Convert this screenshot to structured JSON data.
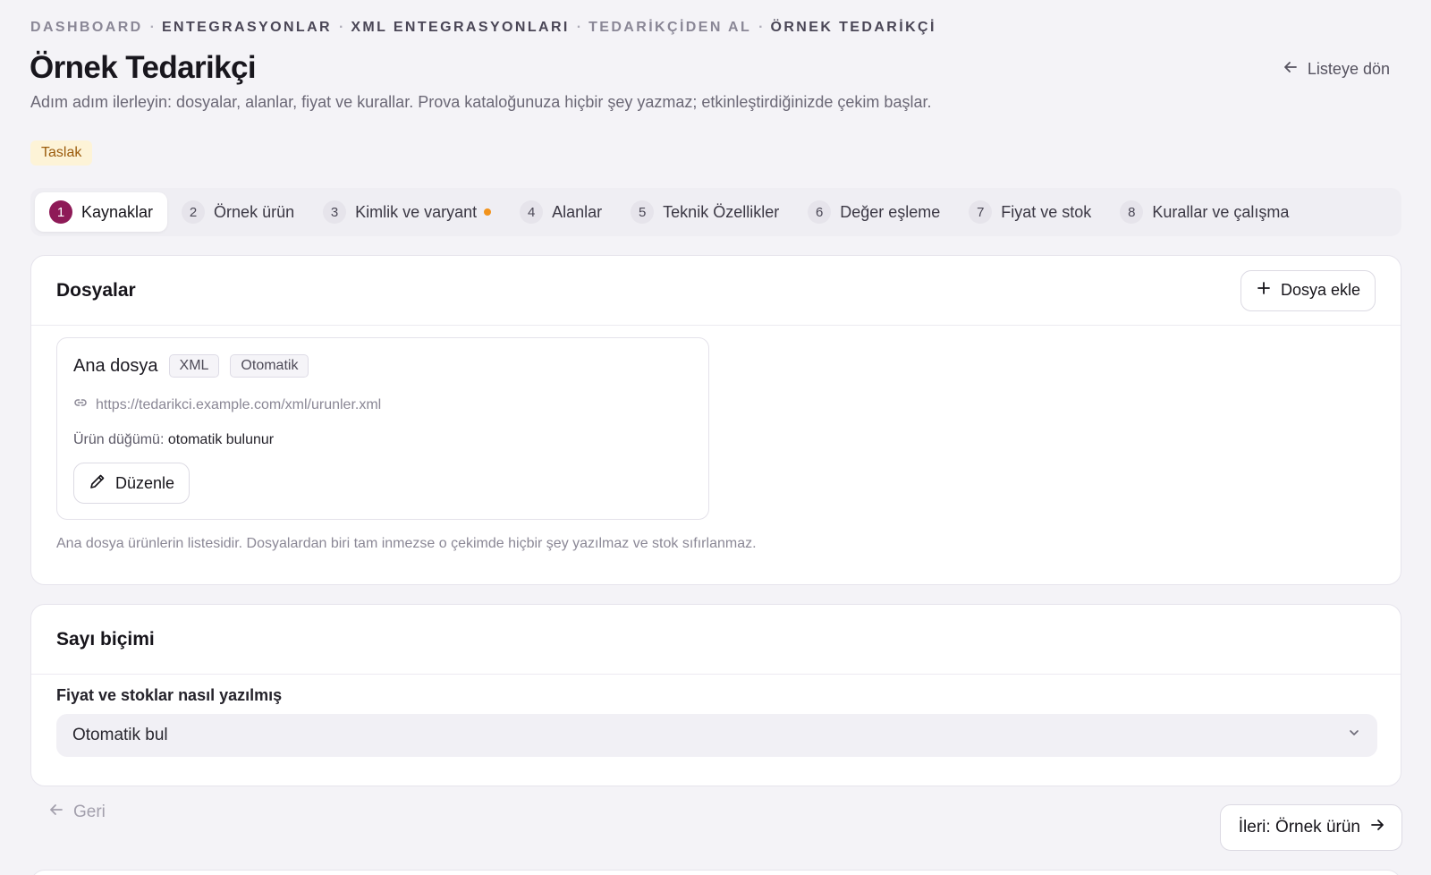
{
  "breadcrumb": [
    "DASHBOARD",
    "ENTEGRASYONLAR",
    "XML ENTEGRASYONLARI",
    "TEDARİKÇİDEN AL",
    "ÖRNEK TEDARİKÇİ"
  ],
  "header": {
    "title": "Örnek Tedarikçi",
    "subtitle": "Adım adım ilerleyin: dosyalar, alanlar, fiyat ve kurallar. Prova kataloğunuza hiçbir şey yazmaz; etkinleştirdiğinizde çekim başlar.",
    "back_label": "Listeye dön",
    "status_badge": "Taslak"
  },
  "steps": [
    {
      "num": "1",
      "label": "Kaynaklar",
      "active": true
    },
    {
      "num": "2",
      "label": "Örnek ürün"
    },
    {
      "num": "3",
      "label": "Kimlik ve varyant",
      "warning": true
    },
    {
      "num": "4",
      "label": "Alanlar"
    },
    {
      "num": "5",
      "label": "Teknik Özellikler"
    },
    {
      "num": "6",
      "label": "Değer eşleme"
    },
    {
      "num": "7",
      "label": "Fiyat ve stok"
    },
    {
      "num": "8",
      "label": "Kurallar ve çalışma"
    }
  ],
  "files_card": {
    "title": "Dosyalar",
    "add_label": "Dosya ekle",
    "file": {
      "name": "Ana dosya",
      "tags": [
        "XML",
        "Otomatik"
      ],
      "url": "https://tedarikci.example.com/xml/urunler.xml",
      "node_label": "Ürün düğümü:",
      "node_value": "otomatik bulunur",
      "edit_label": "Düzenle"
    },
    "note": "Ana dosya ürünlerin listesidir. Dosyalardan biri tam inmezse o çekimde hiçbir şey yazılmaz ve stok sıfırlanmaz."
  },
  "number_card": {
    "title": "Sayı biçimi",
    "field_label": "Fiyat ve stoklar nasıl yazılmış",
    "select_value": "Otomatik bul"
  },
  "nav": {
    "back_label": "Geri",
    "next_label": "İleri: Örnek ürün"
  },
  "colors": {
    "accent": "#8e1a57",
    "warning_dot": "#f2931c",
    "draft_bg": "#fdf3d7",
    "draft_text": "#9b5b0c"
  }
}
